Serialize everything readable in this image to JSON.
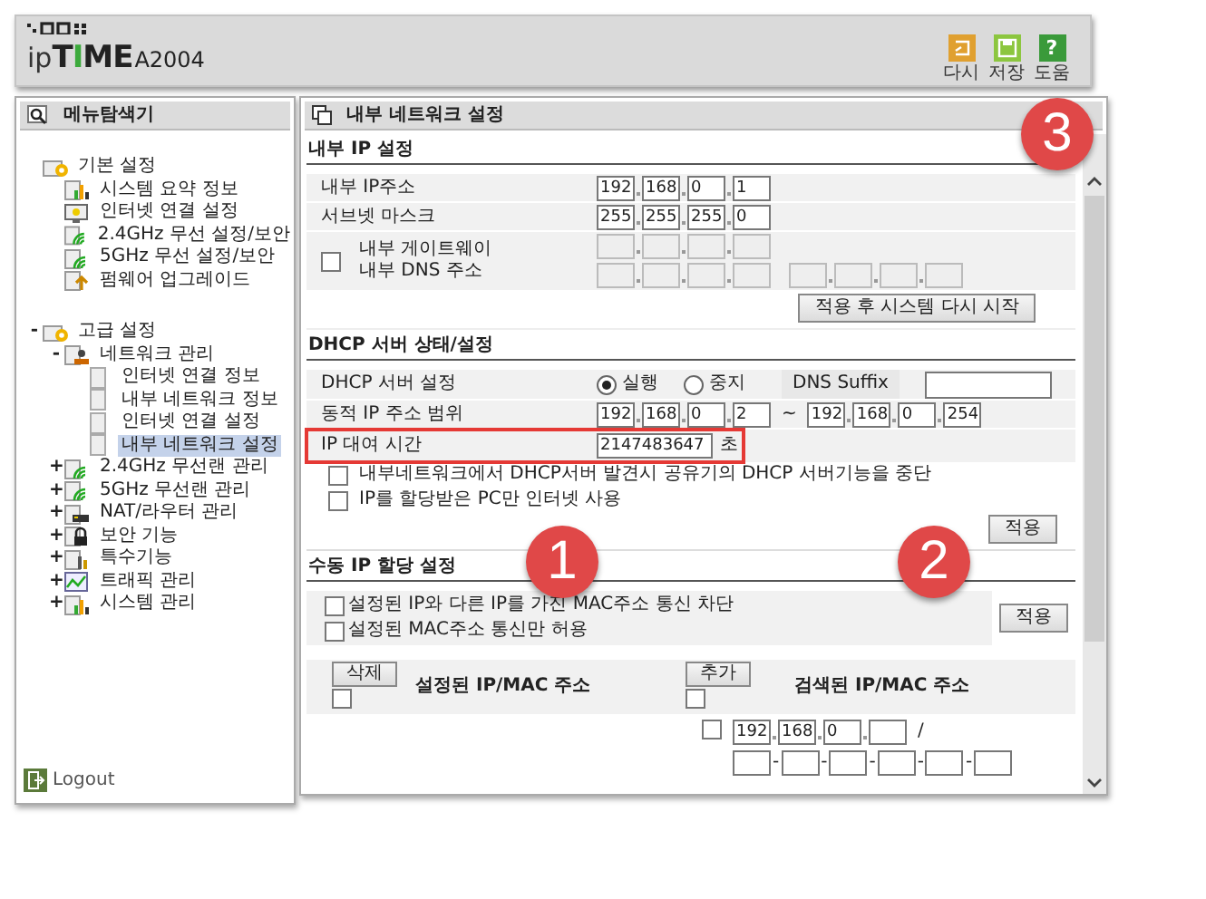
{
  "header": {
    "logo": {
      "prefix": "ip",
      "brand": "TIME",
      "model": "A2004"
    },
    "tools": [
      {
        "kind": "undo",
        "label": "다시"
      },
      {
        "kind": "save",
        "label": "저장"
      },
      {
        "kind": "help",
        "glyph": "?",
        "label": "도움"
      }
    ]
  },
  "sidebar": {
    "title": "메뉴탐색기",
    "tree": [
      {
        "label": "기본 설정",
        "kind": "folder",
        "selected": false,
        "children": [
          {
            "label": "시스템 요약 정보",
            "kind": "chart",
            "selected": false
          },
          {
            "label": "인터넷 연결 설정",
            "kind": "monitor",
            "selected": false
          },
          {
            "label": "2.4GHz 무선 설정/보안",
            "kind": "wifi",
            "selected": false
          },
          {
            "label": "5GHz 무선 설정/보안",
            "kind": "wifi",
            "selected": false
          },
          {
            "label": "펌웨어 업그레이드",
            "kind": "upgrade",
            "selected": false
          }
        ]
      },
      {
        "label": "고급 설정",
        "kind": "folder",
        "toggle": "-",
        "selected": false,
        "children": [
          {
            "label": "네트워크 관리",
            "kind": "network",
            "toggle": "-",
            "selected": false,
            "children": [
              {
                "label": "인터넷 연결 정보",
                "kind": "page",
                "selected": false
              },
              {
                "label": "내부 네트워크 정보",
                "kind": "page",
                "selected": false
              },
              {
                "label": "인터넷 연결 설정",
                "kind": "page",
                "selected": false
              },
              {
                "label": "내부 네트워크 설정",
                "kind": "page",
                "selected": true
              }
            ]
          },
          {
            "label": "2.4GHz 무선랜 관리",
            "kind": "wifi",
            "toggle": "+",
            "selected": false
          },
          {
            "label": "5GHz 무선랜 관리",
            "kind": "wifi",
            "toggle": "+",
            "selected": false
          },
          {
            "label": "NAT/라우터 관리",
            "kind": "router",
            "toggle": "+",
            "selected": false
          },
          {
            "label": "보안 기능",
            "kind": "lock",
            "toggle": "+",
            "selected": false
          },
          {
            "label": "특수기능",
            "kind": "special",
            "toggle": "+",
            "selected": false
          },
          {
            "label": "트래픽 관리",
            "kind": "traffic",
            "toggle": "+",
            "selected": false
          },
          {
            "label": "시스템 관리",
            "kind": "chart",
            "toggle": "+",
            "selected": false
          }
        ]
      }
    ],
    "logout": "Logout"
  },
  "content": {
    "title": "내부 네트워크 설정",
    "lan": {
      "heading": "내부 IP 설정",
      "rows": [
        {
          "label": "내부 IP주소",
          "fields": [
            {
              "value": "192",
              "disabled": false
            },
            {
              "value": "168",
              "disabled": false
            },
            {
              "value": "0",
              "disabled": false
            },
            {
              "value": "1",
              "disabled": false
            }
          ]
        },
        {
          "label": "서브넷 마스크",
          "fields": [
            {
              "value": "255",
              "disabled": false
            },
            {
              "value": "255",
              "disabled": false
            },
            {
              "value": "255",
              "disabled": false
            },
            {
              "value": "0",
              "disabled": false
            }
          ]
        }
      ],
      "gateway": {
        "checked": false,
        "labels": [
          "내부 게이트웨이",
          "내부 DNS 주소"
        ],
        "gateway_fields": [
          {
            "disabled": true
          },
          {
            "disabled": true
          },
          {
            "disabled": true
          },
          {
            "disabled": true
          }
        ],
        "dns_fields": [
          {
            "disabled": true
          },
          {
            "disabled": true
          },
          {
            "disabled": true
          },
          {
            "disabled": true
          }
        ],
        "dns2_fields": [
          {
            "disabled": true
          },
          {
            "disabled": true
          },
          {
            "disabled": true
          },
          {
            "disabled": true
          }
        ]
      },
      "button": "적용 후 시스템 다시 시작"
    },
    "dhcp": {
      "heading": "DHCP 서버 상태/설정",
      "server": {
        "label": "DHCP 서버 설정",
        "options": [
          {
            "label": "실행",
            "selected": true
          },
          {
            "label": "중지",
            "selected": false
          }
        ],
        "suffix_label": "DNS Suffix"
      },
      "range": {
        "label": "동적 IP 주소 범위",
        "start": [
          {
            "value": "192",
            "disabled": false
          },
          {
            "value": "168",
            "disabled": false
          },
          {
            "value": "0",
            "disabled": false
          },
          {
            "value": "2",
            "disabled": false
          }
        ],
        "separator": "~",
        "end": [
          {
            "value": "192",
            "disabled": false
          },
          {
            "value": "168",
            "disabled": false
          },
          {
            "value": "0",
            "disabled": false
          },
          {
            "value": "254",
            "disabled": false
          }
        ]
      },
      "lease": {
        "label": "IP 대여 시간",
        "value": "2147483647",
        "unit": "초",
        "highlighted": true
      },
      "options": [
        {
          "label": "내부네트워크에서 DHCP서버 발견시 공유기의 DHCP 서버기능을 중단",
          "checked": false
        },
        {
          "label": "IP를 할당받은 PC만 인터넷 사용",
          "checked": false
        }
      ],
      "button": "적용"
    },
    "manual": {
      "heading": "수동 IP 할당 설정",
      "options": [
        {
          "label": "설정된 IP와 다른 IP를 가진 MAC주소 통신 차단",
          "checked": false
        },
        {
          "label": "설정된 MAC주소 통신만 허용",
          "checked": false
        }
      ],
      "button": "적용",
      "configured": {
        "button": "삭제",
        "checked": false,
        "heading": "설정된 IP/MAC 주소"
      },
      "found": {
        "button": "추가",
        "checked": false,
        "heading": "검색된 IP/MAC 주소",
        "entry": {
          "checked": false,
          "ip": [
            {
              "value": "192",
              "disabled": false
            },
            {
              "value": "168",
              "disabled": false
            },
            {
              "value": "0",
              "disabled": false
            },
            {
              "disabled": false
            }
          ],
          "slash": "/",
          "mac": [
            {
              "disabled": false
            },
            {
              "disabled": false
            },
            {
              "disabled": false
            },
            {
              "disabled": false
            },
            {
              "disabled": false
            },
            {
              "disabled": false
            }
          ],
          "separator": "-"
        }
      }
    }
  },
  "annotations": [
    {
      "label": "3"
    },
    {
      "label": "1"
    },
    {
      "label": "2"
    }
  ]
}
